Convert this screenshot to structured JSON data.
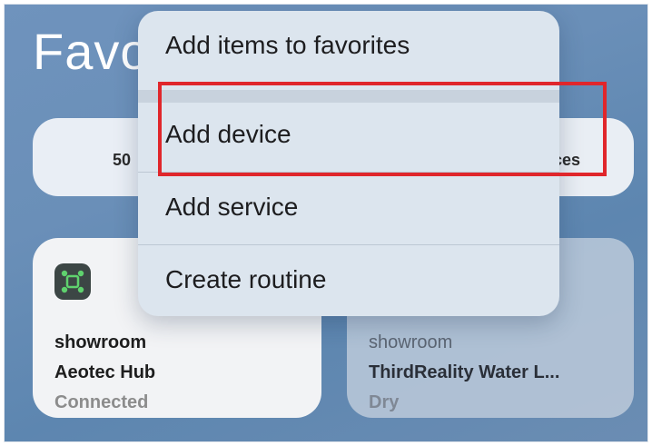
{
  "page": {
    "title": "Favo"
  },
  "summary": {
    "left_text": "50",
    "right_text": "vices"
  },
  "menu": {
    "items": [
      {
        "label": "Add items to favorites"
      },
      {
        "label": "Add device"
      },
      {
        "label": "Add service"
      },
      {
        "label": "Create routine"
      }
    ]
  },
  "cards": [
    {
      "room": "showroom",
      "name": "Aeotec Hub",
      "status": "Connected",
      "icon": "hub-icon"
    },
    {
      "room": "showroom",
      "name": "ThirdReality Water L...",
      "status": "Dry"
    }
  ],
  "colors": {
    "highlight": "#e0262b",
    "hub_icon_green": "#5fd26e"
  }
}
